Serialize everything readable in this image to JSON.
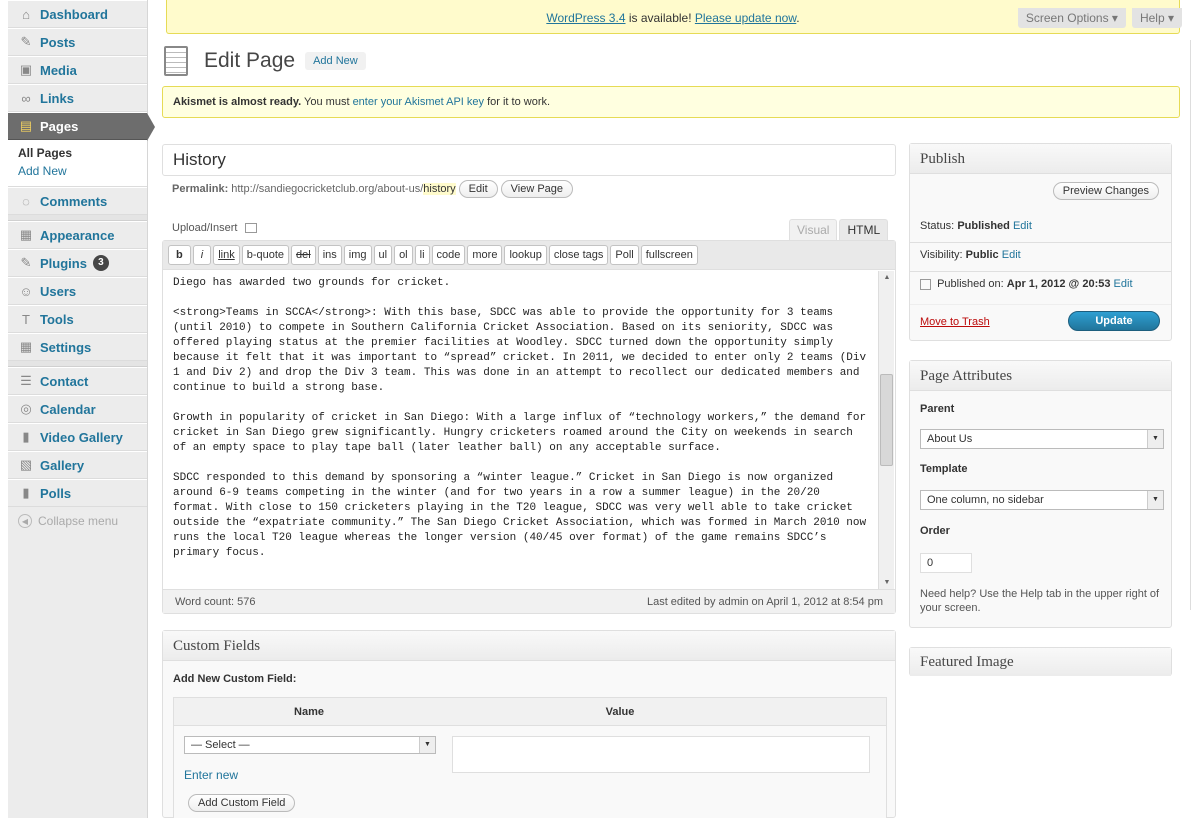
{
  "menu": {
    "items": [
      {
        "label": "Dashboard",
        "icon": "dashboard-icon",
        "glyph": "⌂"
      },
      {
        "label": "Posts",
        "icon": "pushpin-icon",
        "glyph": "✎"
      },
      {
        "label": "Media",
        "icon": "media-icon",
        "glyph": "▣"
      },
      {
        "label": "Links",
        "icon": "links-icon",
        "glyph": "∞"
      },
      {
        "label": "Pages",
        "icon": "pages-icon",
        "glyph": "▤"
      },
      {
        "label": "Comments",
        "icon": "comments-icon",
        "glyph": "◌"
      },
      {
        "label": "Appearance",
        "icon": "appearance-icon",
        "glyph": "▦"
      },
      {
        "label": "Plugins",
        "icon": "plugins-icon",
        "glyph": "✎",
        "badge": "3"
      },
      {
        "label": "Users",
        "icon": "users-icon",
        "glyph": "☺"
      },
      {
        "label": "Tools",
        "icon": "tools-icon",
        "glyph": "T"
      },
      {
        "label": "Settings",
        "icon": "settings-icon",
        "glyph": "▦"
      },
      {
        "label": "Contact",
        "icon": "contact-icon",
        "glyph": "☰"
      },
      {
        "label": "Calendar",
        "icon": "calendar-icon",
        "glyph": "◎"
      },
      {
        "label": "Video Gallery",
        "icon": "video-gallery-icon",
        "glyph": "▮"
      },
      {
        "label": "Gallery",
        "icon": "gallery-icon",
        "glyph": "▧"
      },
      {
        "label": "Polls",
        "icon": "polls-icon",
        "glyph": "▮"
      }
    ],
    "submenu": {
      "all_pages": "All Pages",
      "add_new": "Add New"
    },
    "collapse": "Collapse menu"
  },
  "update_nag": {
    "prefix": "WordPress 3.4",
    "mid": " is available! ",
    "link": "Please update now",
    "suffix": "."
  },
  "screen_meta": {
    "screen_options": "Screen Options ▾",
    "help": "Help ▾"
  },
  "header": {
    "title": "Edit Page",
    "add_new": "Add New"
  },
  "akismet": {
    "bold": "Akismet is almost ready.",
    "text1": " You must ",
    "link": "enter your Akismet API key",
    "text2": " for it to work."
  },
  "post": {
    "title": "History",
    "permalink_label": "Permalink:",
    "permalink_base": "http://sandiegocricketclub.org/about-us/",
    "permalink_slug": "history",
    "edit_btn": "Edit",
    "view_btn": "View Page"
  },
  "editor": {
    "upload_insert": "Upload/Insert",
    "tab_visual": "Visual",
    "tab_html": "HTML",
    "quicktags": [
      "b",
      "i",
      "link",
      "b-quote",
      "del",
      "ins",
      "img",
      "ul",
      "ol",
      "li",
      "code",
      "more",
      "lookup",
      "close tags",
      "Poll",
      "fullscreen"
    ],
    "content": "Diego has awarded two grounds for cricket.\n\n<strong>Teams in SCCA</strong>: With this base, SDCC was able to provide the opportunity for 3 teams (until 2010) to compete in Southern California Cricket Association. Based on its seniority, SDCC was offered playing status at the premier facilities at Woodley. SDCC turned down the opportunity simply because it felt that it was important to “spread” cricket. In 2011, we decided to enter only 2 teams (Div 1 and Div 2) and drop the Div 3 team. This was done in an attempt to recollect our dedicated members and continue to build a strong base.\n\nGrowth in popularity of cricket in San Diego: With a large influx of “technology workers,” the demand for cricket in San Diego grew significantly. Hungry cricketers roamed around the City on weekends in search of an empty space to play tape ball (later leather ball) on any acceptable surface.\n\nSDCC responded to this demand by sponsoring a “winter league.” Cricket in San Diego is now organized around 6-9 teams competing in the winter (and for two years in a row a summer league) in the 20/20 format. With close to 150 cricketers playing in the T20 league, SDCC was very well able to take cricket outside the “expatriate community.” The San Diego Cricket Association, which was formed in March 2010 now runs the local T20 league whereas the longer version (40/45 over format) of the game remains SDCC’s primary focus.",
    "word_count": "Word count: 576",
    "last_edited": "Last edited by admin on April 1, 2012 at 8:54 pm"
  },
  "custom_fields": {
    "title": "Custom Fields",
    "subtitle": "Add New Custom Field:",
    "col_name": "Name",
    "col_value": "Value",
    "select": "— Select —",
    "enter_new": "Enter new",
    "add_btn": "Add Custom Field"
  },
  "publish": {
    "title": "Publish",
    "preview": "Preview Changes",
    "status_label": "Status:",
    "status_value": "Published",
    "visibility_label": "Visibility:",
    "visibility_value": "Public",
    "edit": "Edit",
    "published_on_label": "Published on:",
    "published_on_value": "Apr 1, 2012 @ 20:53",
    "trash": "Move to Trash",
    "update": "Update"
  },
  "page_attributes": {
    "title": "Page Attributes",
    "parent_label": "Parent",
    "parent_value": "About Us",
    "template_label": "Template",
    "template_value": "One column, no sidebar",
    "order_label": "Order",
    "order_value": "0",
    "help": "Need help? Use the Help tab in the upper right of your screen."
  },
  "featured_image": {
    "title": "Featured Image"
  },
  "colors": {
    "link": "#21759b",
    "nag_bg": "#fffbcc",
    "update_btn": "#21759b",
    "trash": "#bc0b0b"
  }
}
